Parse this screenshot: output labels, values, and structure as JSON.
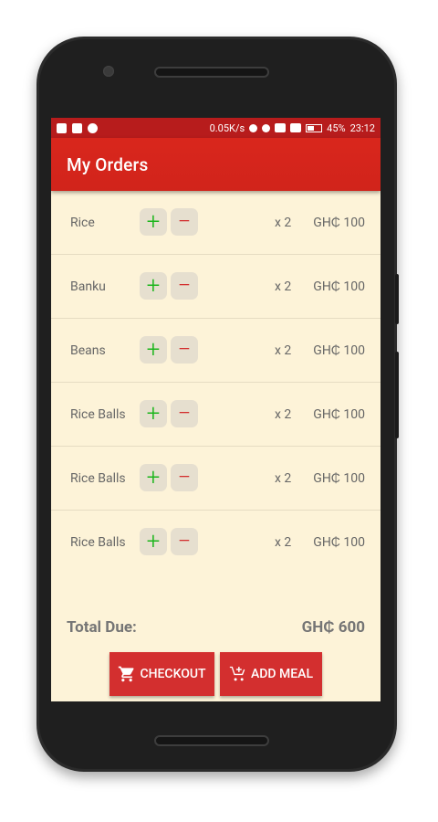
{
  "status_bar": {
    "network_speed": "0.05K/s",
    "battery": "45%",
    "time": "23:12"
  },
  "app_bar": {
    "title": "My Orders"
  },
  "orders": [
    {
      "name": "Rice",
      "plus": "+",
      "minus": "−",
      "qty": "x 2",
      "price": "GH₵ 100"
    },
    {
      "name": "Banku",
      "plus": "+",
      "minus": "−",
      "qty": "x 2",
      "price": "GH₵ 100"
    },
    {
      "name": "Beans",
      "plus": "+",
      "minus": "−",
      "qty": "x 2",
      "price": "GH₵ 100"
    },
    {
      "name": "Rice Balls",
      "plus": "+",
      "minus": "−",
      "qty": "x 2",
      "price": "GH₵ 100"
    },
    {
      "name": "Rice Balls",
      "plus": "+",
      "minus": "−",
      "qty": "x 2",
      "price": "GH₵ 100"
    },
    {
      "name": "Rice Balls",
      "plus": "+",
      "minus": "−",
      "qty": "x 2",
      "price": "GH₵ 100"
    }
  ],
  "total": {
    "label": "Total Due:",
    "value": "GH₵ 600"
  },
  "actions": {
    "checkout_label": "CHECKOUT",
    "checkout_icon": "cart-icon",
    "add_meal_label": "ADD MEAL",
    "add_meal_icon": "add-to-cart-icon"
  },
  "colors": {
    "primary": "#d32f2f",
    "status_bar": "#b71c1c",
    "background": "#fdf3d8",
    "plus": "#1bb51b",
    "minus": "#d32f2f"
  }
}
